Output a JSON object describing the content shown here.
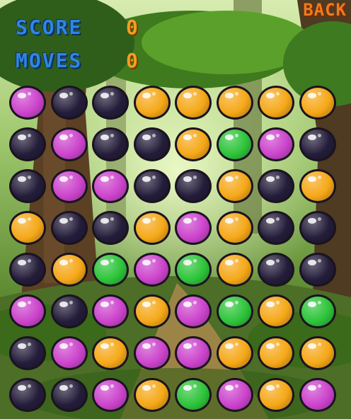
{
  "hud": {
    "score_label": "SCORE",
    "score_value": "0",
    "moves_label": "MOVES",
    "moves_value": "0",
    "back_label": "BACK"
  },
  "colors": {
    "hud_label": "#2f86e0",
    "hud_value": "#f0a020",
    "back": "#f07a1e",
    "purple": "#241d3a",
    "pink": "#cc44cc",
    "orange": "#f5a818",
    "green": "#2ec43a"
  },
  "board": {
    "rows": 8,
    "cols": 8,
    "grid": [
      [
        "pink",
        "purple",
        "purple",
        "orange",
        "orange",
        "orange",
        "orange",
        "orange"
      ],
      [
        "purple",
        "pink",
        "purple",
        "purple",
        "orange",
        "green",
        "pink",
        "purple"
      ],
      [
        "purple",
        "pink",
        "pink",
        "purple",
        "purple",
        "orange",
        "purple",
        "orange"
      ],
      [
        "orange",
        "purple",
        "purple",
        "orange",
        "pink",
        "orange",
        "purple",
        "purple"
      ],
      [
        "purple",
        "orange",
        "green",
        "pink",
        "green",
        "orange",
        "purple",
        "purple"
      ],
      [
        "pink",
        "purple",
        "pink",
        "orange",
        "pink",
        "green",
        "orange",
        "green"
      ],
      [
        "purple",
        "pink",
        "orange",
        "pink",
        "pink",
        "orange",
        "orange",
        "orange"
      ],
      [
        "purple",
        "purple",
        "pink",
        "orange",
        "green",
        "pink",
        "orange",
        "pink"
      ]
    ]
  }
}
